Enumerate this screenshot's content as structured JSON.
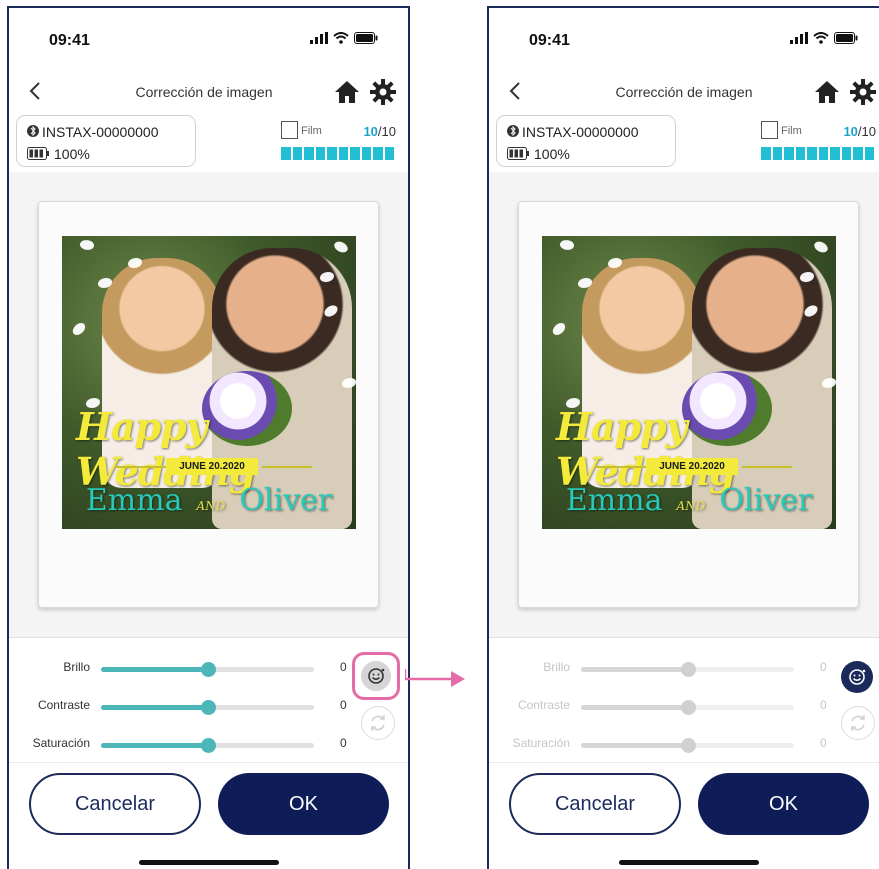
{
  "status_bar": {
    "time": "09:41"
  },
  "header": {
    "title": "Corrección de imagen"
  },
  "device": {
    "name": "INSTAX-00000000",
    "battery": "100%"
  },
  "film": {
    "label": "Film",
    "remaining": "10",
    "total": "/10",
    "level": 10
  },
  "photo_text": {
    "headline": "Happy Wedding",
    "date": "JUNE 20.2020",
    "name_left": "Emma",
    "and": "AND",
    "name_right": "Oliver"
  },
  "sliders": [
    {
      "label": "Brillo",
      "value": "0",
      "position": 0.5
    },
    {
      "label": "Contraste",
      "value": "0",
      "position": 0.5
    },
    {
      "label": "Saturación",
      "value": "0",
      "position": 0.5
    }
  ],
  "buttons": {
    "cancel": "Cancelar",
    "ok": "OK"
  },
  "colors": {
    "accent": "#4db6b9",
    "primary": "#0e1d57",
    "highlight": "#e46aa8",
    "film": "#22bfd4"
  },
  "states": {
    "left": "face-correction-off",
    "right": "face-correction-on"
  }
}
